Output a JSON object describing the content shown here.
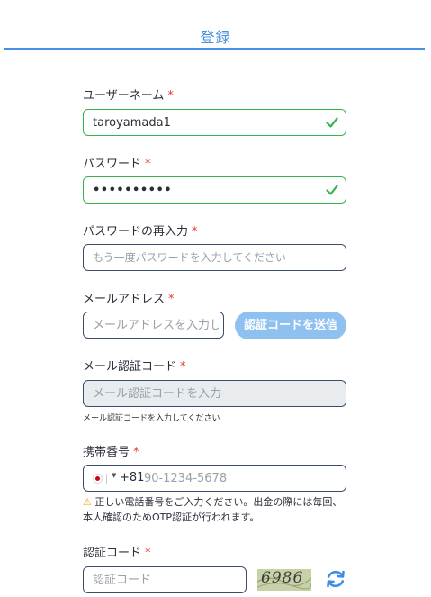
{
  "header": {
    "title": "登録"
  },
  "form": {
    "username": {
      "label": "ユーザーネーム",
      "required_mark": "*",
      "value": "taroyamada1",
      "status": "valid"
    },
    "password": {
      "label": "パスワード",
      "required_mark": "*",
      "value": "••••••••••",
      "status": "valid"
    },
    "password_confirm": {
      "label": "パスワードの再入力",
      "required_mark": "*",
      "placeholder": "もう一度パスワードを入力してください"
    },
    "email": {
      "label": "メールアドレス",
      "required_mark": "*",
      "placeholder": "メールアドレスを入力してください",
      "send_button": "認証コードを送信"
    },
    "email_code": {
      "label": "メール認証コード",
      "required_mark": "*",
      "placeholder": "メール認証コードを入力",
      "hint": "メール認証コードを入力してください"
    },
    "phone": {
      "label": "携帯番号",
      "required_mark": "*",
      "country_code": "+81",
      "placeholder": "90-1234-5678",
      "warning_icon": "⚠",
      "warning": "正しい電話番号をご入力ください。出金の際には毎回、本人確認のためOTP認証が行われます。"
    },
    "captcha": {
      "label": "認証コード",
      "required_mark": "*",
      "placeholder": "認証コード",
      "image_text": "6986"
    }
  },
  "colors": {
    "accent": "#4a90e2",
    "valid": "#34b34a",
    "required": "#e53935",
    "button": "#8fc1f0"
  },
  "icons": {
    "check": "check-icon",
    "flag": "japan-flag-icon",
    "refresh": "refresh-icon",
    "warning": "warning-icon"
  }
}
